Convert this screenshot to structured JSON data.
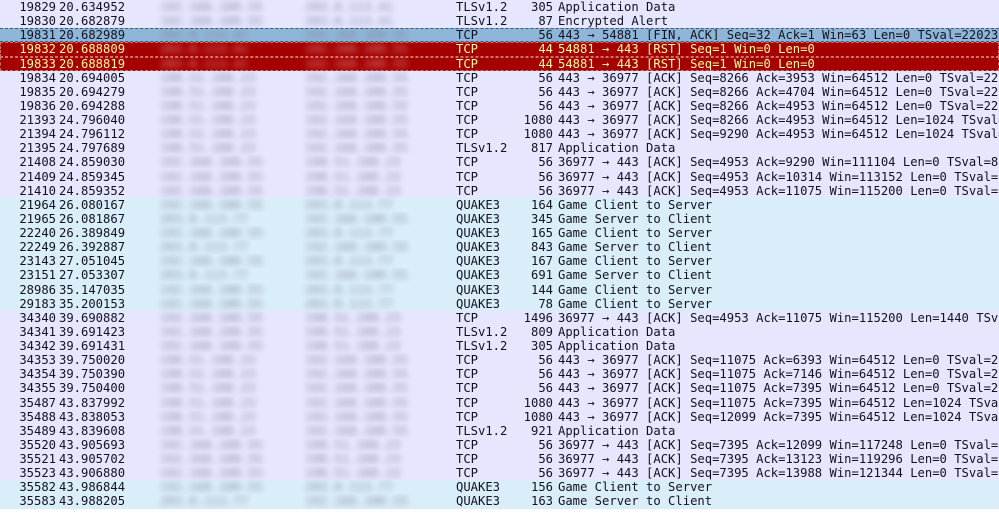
{
  "colors": {
    "tcp": "#e7e6ff",
    "tls": "#e7e6ff",
    "quake": "#daeefa",
    "selected": "#8fb6d8",
    "rst": "#a40000",
    "rst_text": "#fffc9c",
    "text": "#12121e"
  },
  "rows": [
    {
      "no": "19829",
      "time": "20.634952",
      "src": "192.168.100.55",
      "dst": "203.0.113.41",
      "proto": "TLSv1.2",
      "len": "305",
      "info": "Application Data",
      "kind": "tls"
    },
    {
      "no": "19830",
      "time": "20.682879",
      "src": "192.168.100.55",
      "dst": "203.0.113.41",
      "proto": "TLSv1.2",
      "len": "87",
      "info": "Encrypted Alert",
      "kind": "tls"
    },
    {
      "no": "19831",
      "time": "20.682989",
      "src": "203.0.113.41",
      "dst": "192.168.100.55",
      "proto": "TCP",
      "len": "56",
      "info": "443 → 54881 [FIN, ACK] Seq=32 Ack=1 Win=63 Len=0 TSval=220237…",
      "kind": "selected"
    },
    {
      "no": "19832",
      "time": "20.688809",
      "src": "203.0.113.41",
      "dst": "192.168.100.55",
      "proto": "TCP",
      "len": "44",
      "info": "54881 → 443 [RST] Seq=1 Win=0 Len=0",
      "kind": "rst"
    },
    {
      "no": "19833",
      "time": "20.688819",
      "src": "203.0.113.41",
      "dst": "192.168.100.55",
      "proto": "TCP",
      "len": "44",
      "info": "54881 → 443 [RST] Seq=1 Win=0 Len=0",
      "kind": "rst"
    },
    {
      "no": "19834",
      "time": "20.694005",
      "src": "198.51.100.23",
      "dst": "192.168.100.55",
      "proto": "TCP",
      "len": "56",
      "info": "443 → 36977 [ACK] Seq=8266 Ack=3953 Win=64512 Len=0 TSval=220…",
      "kind": "tcp"
    },
    {
      "no": "19835",
      "time": "20.694279",
      "src": "198.51.100.23",
      "dst": "192.168.100.55",
      "proto": "TCP",
      "len": "56",
      "info": "443 → 36977 [ACK] Seq=8266 Ack=4704 Win=64512 Len=0 TSval=220…",
      "kind": "tcp"
    },
    {
      "no": "19836",
      "time": "20.694288",
      "src": "198.51.100.23",
      "dst": "192.168.100.55",
      "proto": "TCP",
      "len": "56",
      "info": "443 → 36977 [ACK] Seq=8266 Ack=4953 Win=64512 Len=0 TSval=220…",
      "kind": "tcp"
    },
    {
      "no": "21393",
      "time": "24.796040",
      "src": "198.51.100.23",
      "dst": "192.168.100.55",
      "proto": "TCP",
      "len": "1080",
      "info": "443 → 36977 [ACK] Seq=8266 Ack=4953 Win=64512 Len=1024 TSval=…",
      "kind": "tcp"
    },
    {
      "no": "21394",
      "time": "24.796112",
      "src": "198.51.100.23",
      "dst": "192.168.100.55",
      "proto": "TCP",
      "len": "1080",
      "info": "443 → 36977 [ACK] Seq=9290 Ack=4953 Win=64512 Len=1024 TSval=…",
      "kind": "tcp"
    },
    {
      "no": "21395",
      "time": "24.797689",
      "src": "198.51.100.23",
      "dst": "192.168.100.55",
      "proto": "TLSv1.2",
      "len": "817",
      "info": "Application Data",
      "kind": "tls"
    },
    {
      "no": "21408",
      "time": "24.859030",
      "src": "192.168.100.55",
      "dst": "198.51.100.23",
      "proto": "TCP",
      "len": "56",
      "info": "36977 → 443 [ACK] Seq=4953 Ack=9290 Win=111104 Len=0 TSval=81…",
      "kind": "tcp"
    },
    {
      "no": "21409",
      "time": "24.859345",
      "src": "192.168.100.55",
      "dst": "198.51.100.23",
      "proto": "TCP",
      "len": "56",
      "info": "36977 → 443 [ACK] Seq=4953 Ack=10314 Win=113152 Len=0 TSval=8…",
      "kind": "tcp"
    },
    {
      "no": "21410",
      "time": "24.859352",
      "src": "192.168.100.55",
      "dst": "198.51.100.23",
      "proto": "TCP",
      "len": "56",
      "info": "36977 → 443 [ACK] Seq=4953 Ack=11075 Win=115200 Len=0 TSval=8…",
      "kind": "tcp"
    },
    {
      "no": "21964",
      "time": "26.080167",
      "src": "192.168.100.55",
      "dst": "203.0.113.77",
      "proto": "QUAKE3",
      "len": "164",
      "info": "Game Client to Server",
      "kind": "quake"
    },
    {
      "no": "21965",
      "time": "26.081867",
      "src": "203.0.113.77",
      "dst": "192.168.100.55",
      "proto": "QUAKE3",
      "len": "345",
      "info": "Game Server to Client",
      "kind": "quake"
    },
    {
      "no": "22240",
      "time": "26.389849",
      "src": "192.168.100.55",
      "dst": "203.0.113.77",
      "proto": "QUAKE3",
      "len": "165",
      "info": "Game Client to Server",
      "kind": "quake"
    },
    {
      "no": "22249",
      "time": "26.392887",
      "src": "203.0.113.77",
      "dst": "192.168.100.55",
      "proto": "QUAKE3",
      "len": "843",
      "info": "Game Server to Client",
      "kind": "quake"
    },
    {
      "no": "23143",
      "time": "27.051045",
      "src": "192.168.100.55",
      "dst": "203.0.113.77",
      "proto": "QUAKE3",
      "len": "167",
      "info": "Game Client to Server",
      "kind": "quake"
    },
    {
      "no": "23151",
      "time": "27.053307",
      "src": "203.0.113.77",
      "dst": "192.168.100.55",
      "proto": "QUAKE3",
      "len": "691",
      "info": "Game Server to Client",
      "kind": "quake"
    },
    {
      "no": "28986",
      "time": "35.147035",
      "src": "192.168.100.55",
      "dst": "203.0.113.77",
      "proto": "QUAKE3",
      "len": "144",
      "info": "Game Client to Server",
      "kind": "quake"
    },
    {
      "no": "29183",
      "time": "35.200153",
      "src": "192.168.100.55",
      "dst": "203.0.113.77",
      "proto": "QUAKE3",
      "len": "78",
      "info": "Game Client to Server",
      "kind": "quake"
    },
    {
      "no": "34340",
      "time": "39.690882",
      "src": "192.168.100.55",
      "dst": "198.51.100.23",
      "proto": "TCP",
      "len": "1496",
      "info": "36977 → 443 [ACK] Seq=4953 Ack=11075 Win=115200 Len=1440 TSva…",
      "kind": "tcp"
    },
    {
      "no": "34341",
      "time": "39.691423",
      "src": "192.168.100.55",
      "dst": "198.51.100.23",
      "proto": "TLSv1.2",
      "len": "809",
      "info": "Application Data",
      "kind": "tls"
    },
    {
      "no": "34342",
      "time": "39.691431",
      "src": "192.168.100.55",
      "dst": "198.51.100.23",
      "proto": "TLSv1.2",
      "len": "305",
      "info": "Application Data",
      "kind": "tls"
    },
    {
      "no": "34353",
      "time": "39.750020",
      "src": "198.51.100.23",
      "dst": "192.168.100.55",
      "proto": "TCP",
      "len": "56",
      "info": "443 → 36977 [ACK] Seq=11075 Ack=6393 Win=64512 Len=0 TSval=22…",
      "kind": "tcp"
    },
    {
      "no": "34354",
      "time": "39.750390",
      "src": "198.51.100.23",
      "dst": "192.168.100.55",
      "proto": "TCP",
      "len": "56",
      "info": "443 → 36977 [ACK] Seq=11075 Ack=7146 Win=64512 Len=0 TSval=22…",
      "kind": "tcp"
    },
    {
      "no": "34355",
      "time": "39.750400",
      "src": "198.51.100.23",
      "dst": "192.168.100.55",
      "proto": "TCP",
      "len": "56",
      "info": "443 → 36977 [ACK] Seq=11075 Ack=7395 Win=64512 Len=0 TSval=22…",
      "kind": "tcp"
    },
    {
      "no": "35487",
      "time": "43.837992",
      "src": "198.51.100.23",
      "dst": "192.168.100.55",
      "proto": "TCP",
      "len": "1080",
      "info": "443 → 36977 [ACK] Seq=11075 Ack=7395 Win=64512 Len=1024 TSval…",
      "kind": "tcp"
    },
    {
      "no": "35488",
      "time": "43.838053",
      "src": "198.51.100.23",
      "dst": "192.168.100.55",
      "proto": "TCP",
      "len": "1080",
      "info": "443 → 36977 [ACK] Seq=12099 Ack=7395 Win=64512 Len=1024 TSval…",
      "kind": "tcp"
    },
    {
      "no": "35489",
      "time": "43.839608",
      "src": "198.51.100.23",
      "dst": "192.168.100.55",
      "proto": "TLSv1.2",
      "len": "921",
      "info": "Application Data",
      "kind": "tls"
    },
    {
      "no": "35520",
      "time": "43.905693",
      "src": "192.168.100.55",
      "dst": "198.51.100.23",
      "proto": "TCP",
      "len": "56",
      "info": "36977 → 443 [ACK] Seq=7395 Ack=12099 Win=117248 Len=0 TSval=8…",
      "kind": "tcp"
    },
    {
      "no": "35521",
      "time": "43.905702",
      "src": "192.168.100.55",
      "dst": "198.51.100.23",
      "proto": "TCP",
      "len": "56",
      "info": "36977 → 443 [ACK] Seq=7395 Ack=13123 Win=119296 Len=0 TSval=8…",
      "kind": "tcp"
    },
    {
      "no": "35523",
      "time": "43.906880",
      "src": "192.168.100.55",
      "dst": "198.51.100.23",
      "proto": "TCP",
      "len": "56",
      "info": "36977 → 443 [ACK] Seq=7395 Ack=13988 Win=121344 Len=0 TSval=8…",
      "kind": "tcp"
    },
    {
      "no": "35582",
      "time": "43.986844",
      "src": "192.168.100.55",
      "dst": "203.0.113.77",
      "proto": "QUAKE3",
      "len": "156",
      "info": "Game Client to Server",
      "kind": "quake"
    },
    {
      "no": "35583",
      "time": "43.988205",
      "src": "203.0.113.77",
      "dst": "192.168.100.55",
      "proto": "QUAKE3",
      "len": "163",
      "info": "Game Server to Client",
      "kind": "quake"
    }
  ]
}
